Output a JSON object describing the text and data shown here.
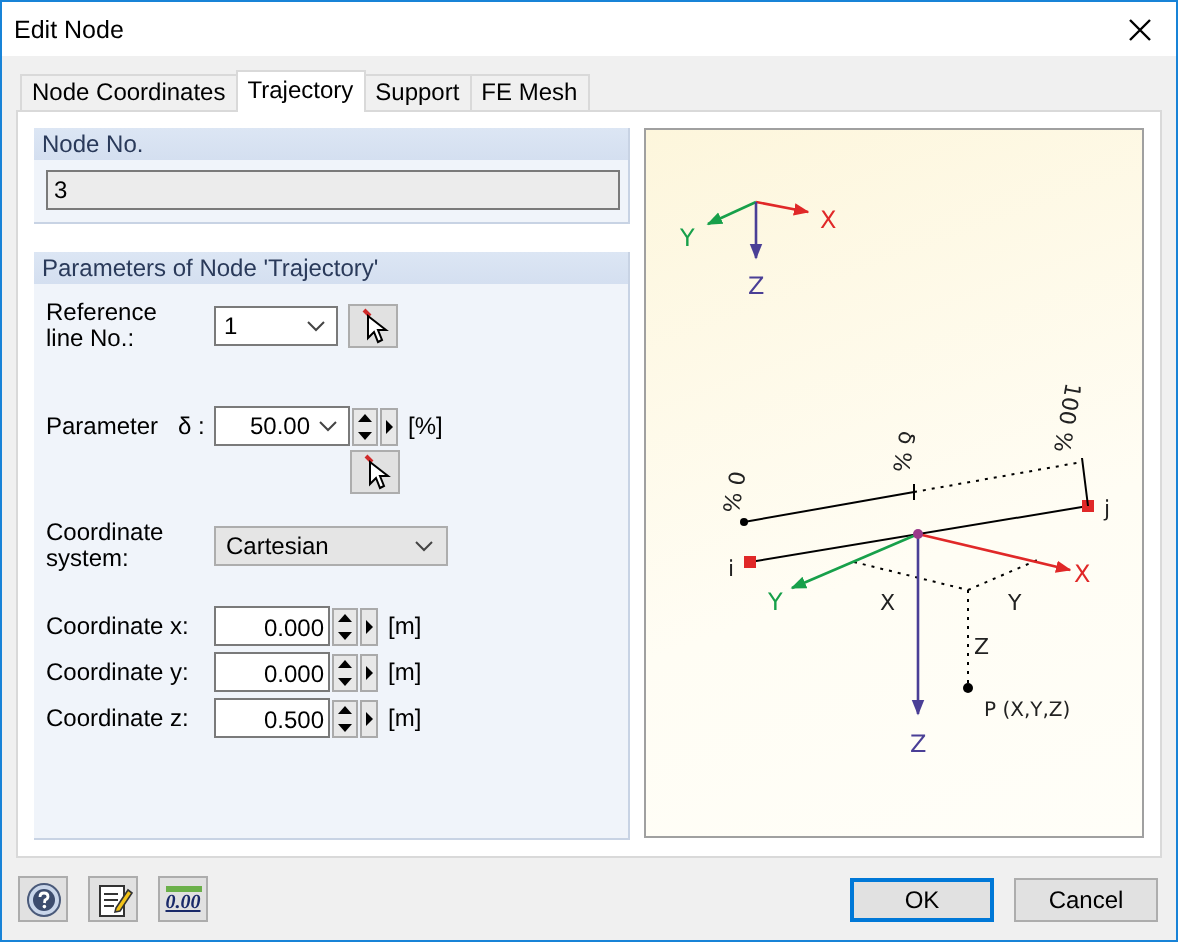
{
  "window": {
    "title": "Edit Node"
  },
  "tabs": [
    {
      "label": "Node Coordinates",
      "selected": false
    },
    {
      "label": "Trajectory",
      "selected": true
    },
    {
      "label": "Support",
      "selected": false
    },
    {
      "label": "FE Mesh",
      "selected": false
    }
  ],
  "node_no": {
    "label": "Node No.",
    "value": "3"
  },
  "parameters": {
    "title": "Parameters of Node 'Trajectory'",
    "reference_line": {
      "label": "Reference line No.:",
      "value": "1"
    },
    "parameter": {
      "label": "Parameter",
      "symbol": "δ :",
      "value": "50.00",
      "unit": "[%]"
    },
    "coordinate_system": {
      "label": "Coordinate system:",
      "value": "Cartesian"
    },
    "coordinates": [
      {
        "label": "Coordinate x:",
        "value": "0.000",
        "unit": "[m]"
      },
      {
        "label": "Coordinate y:",
        "value": "0.000",
        "unit": "[m]"
      },
      {
        "label": "Coordinate z:",
        "value": "0.500",
        "unit": "[m]"
      }
    ]
  },
  "diagram": {
    "global_axes": {
      "x": "X",
      "y": "Y",
      "z": "Z"
    },
    "member_axes": {
      "x": "X",
      "y": "Y",
      "z": "Z"
    },
    "stations": [
      "0 %",
      "δ %",
      "100 %"
    ],
    "ends": {
      "start": "i",
      "end": "j"
    },
    "offsets": {
      "x": "X",
      "y": "Y",
      "z": "Z"
    },
    "point": "P (X,Y,Z)"
  },
  "footer": {
    "units_icon_text": "0.00",
    "buttons": [
      {
        "label": "OK",
        "default": true
      },
      {
        "label": "Cancel",
        "default": false
      }
    ]
  }
}
